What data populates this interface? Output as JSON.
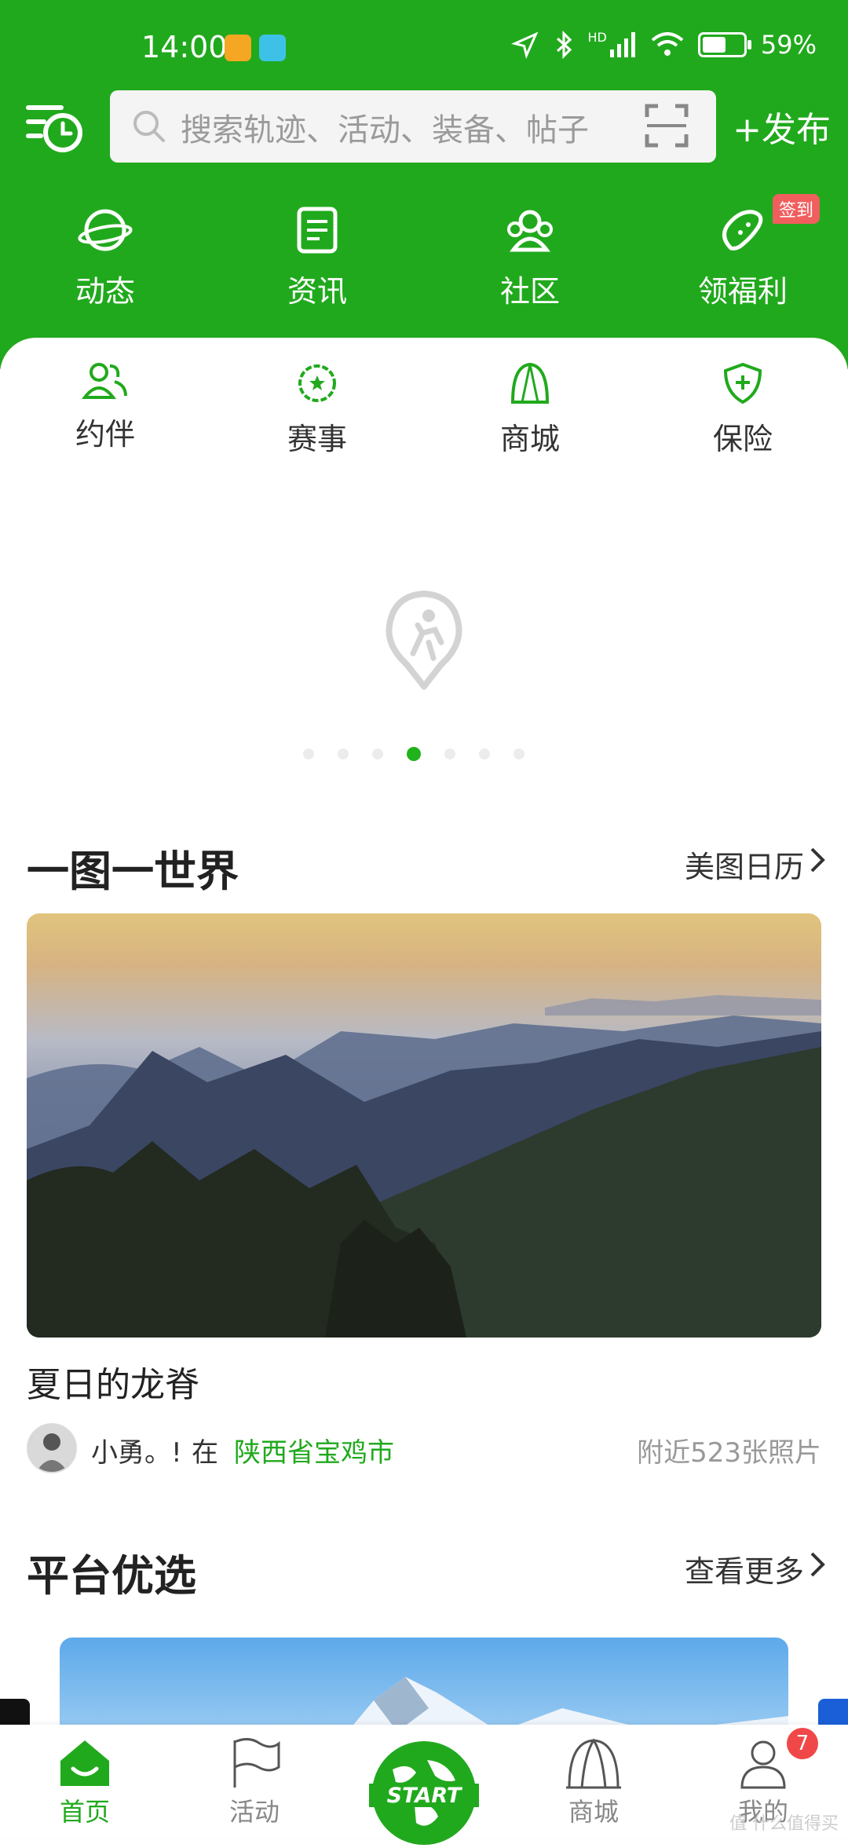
{
  "status_bar": {
    "time": "14:00",
    "battery": "59%",
    "battery_level": 0.59,
    "network": "HD"
  },
  "search": {
    "placeholder": "搜索轨迹、活动、装备、帖子"
  },
  "publish_label": "+发布",
  "quick_nav": [
    {
      "label": "动态",
      "icon": "planet-icon"
    },
    {
      "label": "资讯",
      "icon": "news-icon"
    },
    {
      "label": "社区",
      "icon": "community-icon"
    },
    {
      "label": "领福利",
      "icon": "bean-icon"
    }
  ],
  "signin_badge": "签到",
  "sub_nav": [
    {
      "label": "约伴",
      "icon": "partners-icon"
    },
    {
      "label": "赛事",
      "icon": "medal-icon"
    },
    {
      "label": "商城",
      "icon": "tent-icon"
    },
    {
      "label": "保险",
      "icon": "shield-plus-icon"
    }
  ],
  "banner": {
    "dots": 7,
    "active_dot": 4
  },
  "section_photo": {
    "title": "一图一世界",
    "more": "美图日历",
    "photo_title": "夏日的龙脊",
    "author": "小勇。!",
    "in_label": "在",
    "location": "陕西省宝鸡市",
    "nearby": "附近523张照片"
  },
  "section_featured": {
    "title": "平台优选",
    "more": "查看更多"
  },
  "tabs": [
    {
      "label": "首页",
      "active": true
    },
    {
      "label": "活动",
      "active": false
    },
    {
      "label": "START",
      "active": false
    },
    {
      "label": "商城",
      "active": false
    },
    {
      "label": "我的",
      "active": false
    }
  ],
  "profile_badge": "7",
  "watermark": "值 什么值得买",
  "colors": {
    "brand_green": "#21a91d",
    "badge_red": "#f04848"
  }
}
